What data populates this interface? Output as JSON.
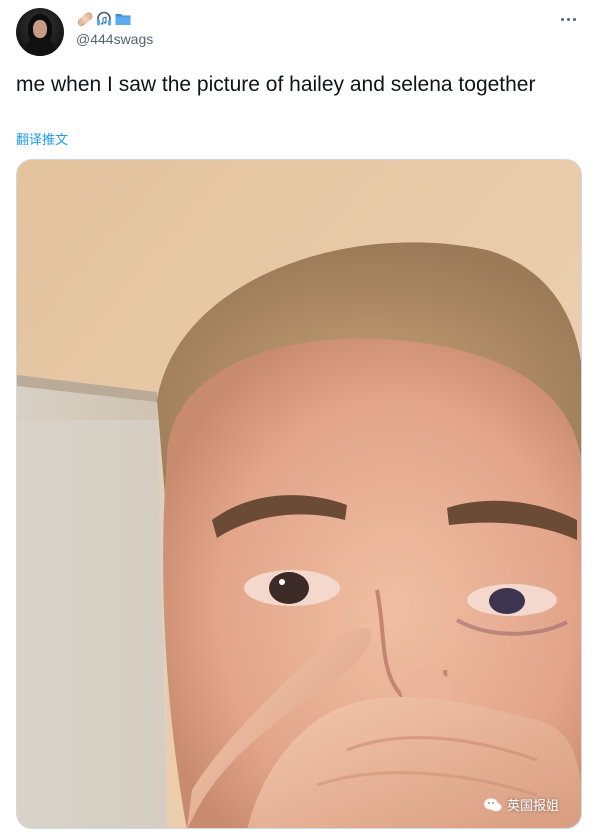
{
  "tweet": {
    "handle": "@444swags",
    "text": "me when I saw the picture of hailey and selena together",
    "translate_label": "翻译推文",
    "name_emojis": [
      "adhesive-bandage",
      "headphone-music-note",
      "folder"
    ]
  },
  "media": {
    "watermark": "英国报姐"
  },
  "colors": {
    "link": "#1d9bf0",
    "secondary_text": "#536471",
    "border": "#cfd9de"
  }
}
